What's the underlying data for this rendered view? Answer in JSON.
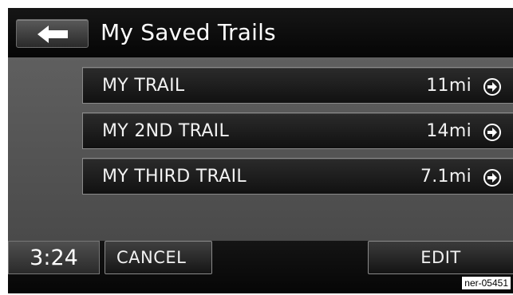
{
  "header": {
    "back_icon": "left-arrow-icon",
    "title": "My Saved Trails"
  },
  "trails": [
    {
      "name": "MY TRAIL",
      "distance": "11mi",
      "icon": "go-arrow-circle-icon"
    },
    {
      "name": "MY 2ND TRAIL",
      "distance": "14mi",
      "icon": "go-arrow-circle-icon"
    },
    {
      "name": "MY THIRD TRAIL",
      "distance": "7.1mi",
      "icon": "go-arrow-circle-icon"
    }
  ],
  "footer": {
    "clock": "3:24",
    "cancel_label": "CANCEL",
    "edit_label": "EDIT"
  },
  "reference_code": "ner-05451",
  "colors": {
    "background": "#0b0b0b",
    "panel": "#555555",
    "text": "#ffffff"
  }
}
